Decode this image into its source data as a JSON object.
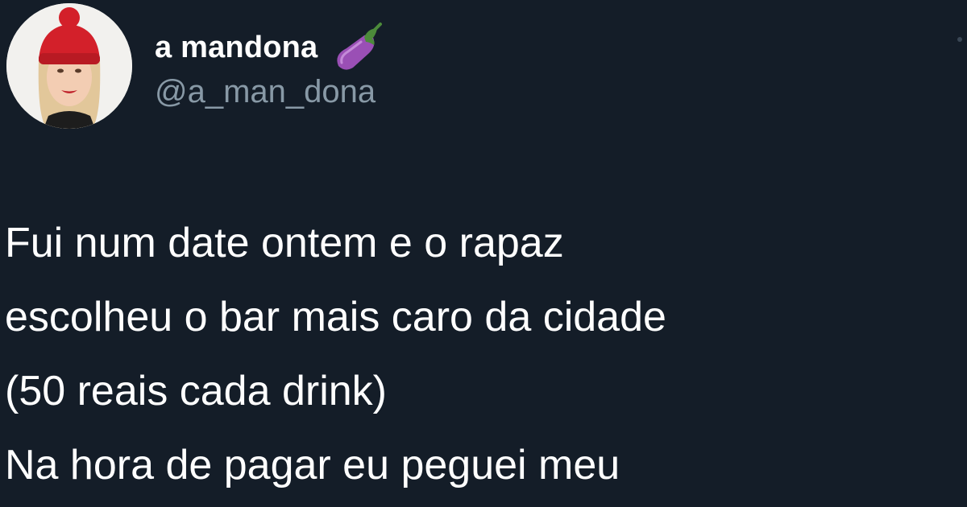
{
  "tweet": {
    "author": {
      "display_name": "a mandona",
      "handle": "@a_man_dona",
      "name_emoji": "eggplant-emoji-icon"
    },
    "text_lines": [
      "Fui num date ontem e o rapaz",
      "escolheu o bar mais caro da cidade",
      "(50 reais cada drink)",
      "Na hora de pagar eu peguei meu"
    ]
  },
  "colors": {
    "background": "#141d28",
    "text_primary": "#ffffff",
    "text_secondary": "#8899a6"
  }
}
